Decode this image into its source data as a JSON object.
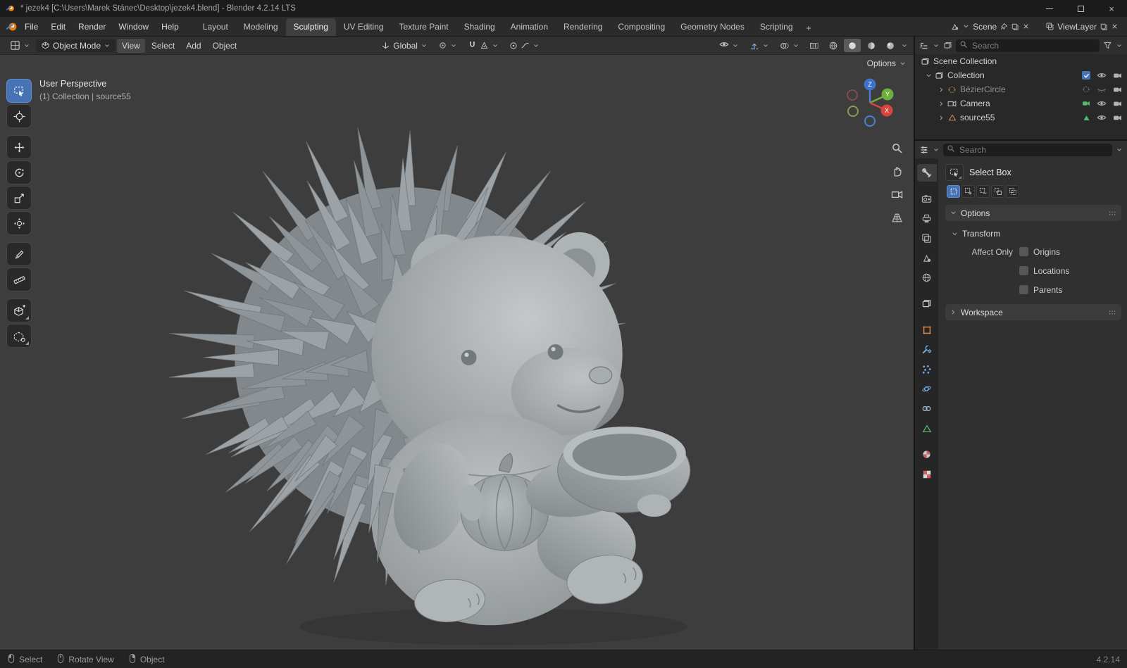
{
  "window": {
    "title": "* jezek4 [C:\\Users\\Marek Stánec\\Desktop\\jezek4.blend] - Blender 4.2.14 LTS"
  },
  "topbar": {
    "menus": [
      {
        "label": "File"
      },
      {
        "label": "Edit"
      },
      {
        "label": "Render"
      },
      {
        "label": "Window"
      },
      {
        "label": "Help"
      }
    ],
    "workspaces": [
      {
        "label": "Layout"
      },
      {
        "label": "Modeling"
      },
      {
        "label": "Sculpting"
      },
      {
        "label": "UV Editing"
      },
      {
        "label": "Texture Paint"
      },
      {
        "label": "Shading"
      },
      {
        "label": "Animation"
      },
      {
        "label": "Rendering"
      },
      {
        "label": "Compositing"
      },
      {
        "label": "Geometry Nodes"
      },
      {
        "label": "Scripting"
      }
    ],
    "active_workspace": "Sculpting",
    "add_workspace_label": "+",
    "scene": {
      "label": "Scene"
    },
    "view_layer": {
      "label": "ViewLayer"
    }
  },
  "viewport_header": {
    "mode_label": "Object Mode",
    "menus": [
      {
        "label": "View"
      },
      {
        "label": "Select"
      },
      {
        "label": "Add"
      },
      {
        "label": "Object"
      }
    ],
    "orientation_label": "Global"
  },
  "viewport": {
    "view_label": "User Perspective",
    "context_label": "(1) Collection | source55",
    "options_label": "Options",
    "gizmo": {
      "x": "X",
      "y": "Y",
      "z": "Z"
    }
  },
  "outliner": {
    "search_placeholder": "Search",
    "rows": [
      {
        "label": "Scene Collection",
        "type": "scene-collection"
      },
      {
        "label": "Collection",
        "type": "collection",
        "checkbox": true
      },
      {
        "label": "BézierCircle",
        "type": "curve",
        "dimmed": true
      },
      {
        "label": "Camera",
        "type": "camera"
      },
      {
        "label": "source55",
        "type": "mesh"
      }
    ]
  },
  "properties": {
    "search_placeholder": "Search",
    "tool_label": "Select Box",
    "options_label": "Options",
    "transform_label": "Transform",
    "workspace_label": "Workspace",
    "affect_only_label": "Affect Only",
    "affect_options": [
      {
        "label": "Origins",
        "checked": false
      },
      {
        "label": "Locations",
        "checked": false
      },
      {
        "label": "Parents",
        "checked": false
      }
    ],
    "tabs": [
      "tool",
      "render",
      "output",
      "view-layer",
      "scene",
      "world",
      "collection",
      "object",
      "modifiers",
      "particles",
      "physics",
      "constraints",
      "object-data",
      "material",
      "texture"
    ]
  },
  "statusbar": {
    "hints": [
      {
        "label": "Select"
      },
      {
        "label": "Rotate View"
      },
      {
        "label": "Object"
      }
    ],
    "version": "4.2.14"
  },
  "colors": {
    "accent_blue": "#4772b3",
    "object_orange": "#dd8d50",
    "data_green": "#55b66e",
    "viewport_bg": "#3d3d3d",
    "model_gray": "#a6abae"
  }
}
